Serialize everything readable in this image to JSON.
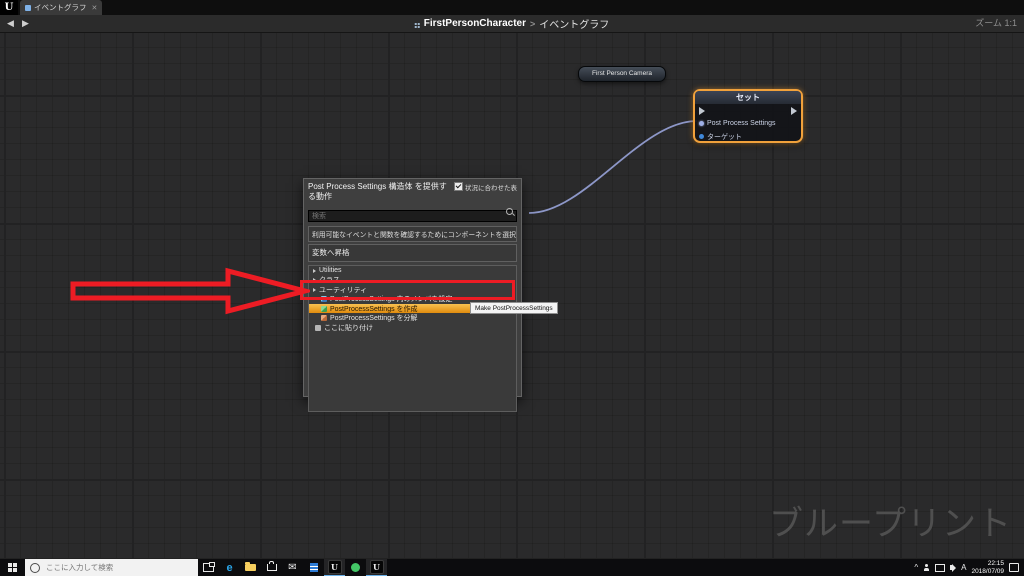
{
  "tabbar": {
    "logo": "U",
    "tab_label": "イベントグラフ",
    "tab_close": "✕"
  },
  "toolbar": {
    "back": "◀",
    "forward": "▶",
    "breadcrumb_root": "FirstPersonCharacter",
    "breadcrumb_sep": ">",
    "breadcrumb_current": "イベントグラフ",
    "zoom_label": "ズーム 1:1"
  },
  "graph": {
    "camera_node_title": "First Person Camera",
    "set_node": {
      "title": "セット",
      "pin_pps": "Post Process Settings",
      "pin_target": "ターゲット"
    },
    "watermark": "ブループリント"
  },
  "context_menu": {
    "title": "Post Process Settings 構造体 を提供する動作",
    "context_toggle_label": "状況に合わせた表示",
    "search_placeholder": "検索",
    "hint": "利用可能なイベントと関数を確認するためにコンポーネントを選択",
    "promote_label": "変数へ昇格",
    "categories": [
      {
        "label": "Utilities"
      },
      {
        "label": "クラス"
      },
      {
        "label": "ユーティリティ"
      }
    ],
    "items": [
      {
        "label": "PostProcessSettings 内のメンバを設定"
      },
      {
        "label": "PostProcessSettings を作成"
      },
      {
        "label": "PostProcessSettings を分解"
      },
      {
        "label": "ここに貼り付け"
      }
    ],
    "tooltip": "Make PostProcessSettings"
  },
  "taskbar": {
    "search_placeholder": "ここに入力して検索",
    "edge_glyph": "e",
    "mail_glyph": "✉",
    "unreal_glyph": "U",
    "tray_chevron": "^",
    "ime": "A",
    "time": "22:15",
    "date": "2018/07/09"
  }
}
